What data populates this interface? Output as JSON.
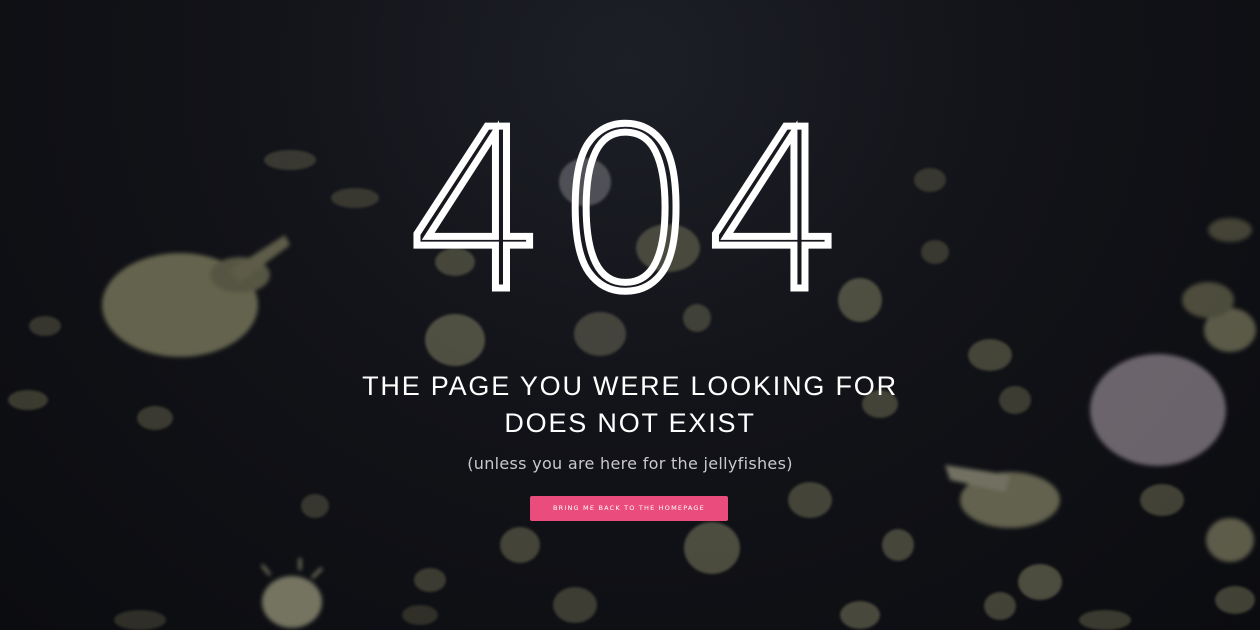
{
  "error": {
    "code": "404",
    "headline": "THE PAGE YOU WERE LOOKING FOR DOES NOT EXIST",
    "subtext": "(unless you are here for the jellyfishes)",
    "button_label": "bring me back to the homepage"
  },
  "colors": {
    "background": "#0d0e12",
    "text": "#ffffff",
    "subtext": "#c9c9cc",
    "button": "#ea4c7e",
    "jellyfish": "#b7b48a"
  },
  "background": {
    "icon": "jellyfish-swarm"
  }
}
